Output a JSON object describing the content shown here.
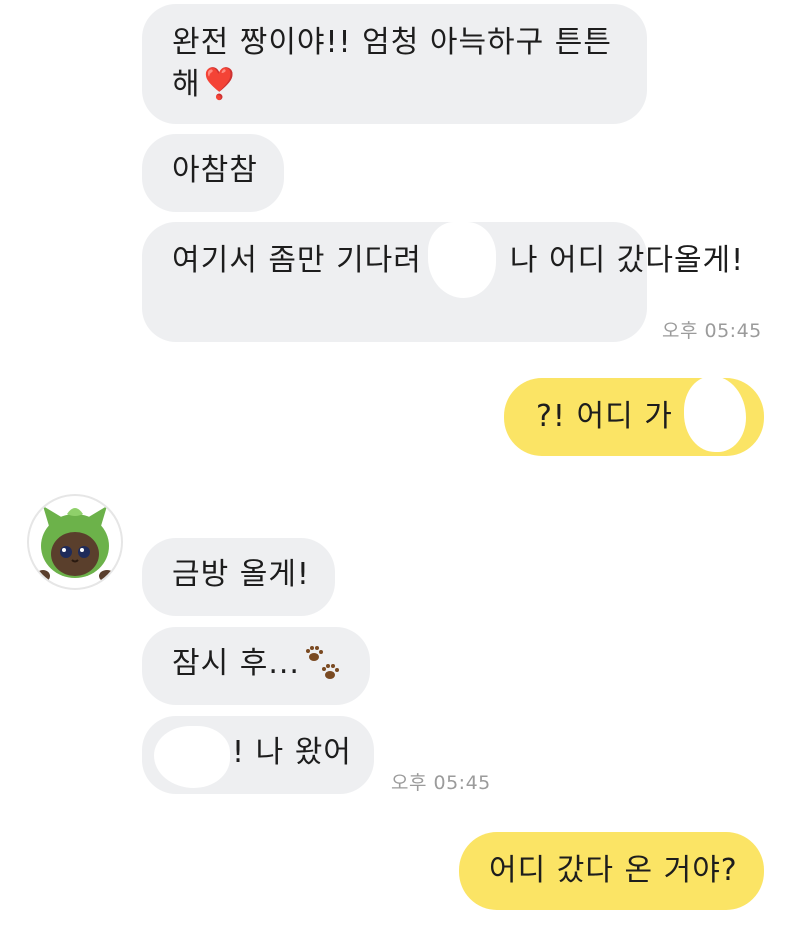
{
  "messages": [
    {
      "side": "in",
      "text": "완전 짱이야!! 엄청 아늑하구 튼튼해❣️"
    },
    {
      "side": "in",
      "text": "아참참"
    },
    {
      "side": "in",
      "text_before": "여기서 좀만 기다려",
      "text_after": "나 어디 갔다올게!",
      "time": "오후 05:45"
    },
    {
      "side": "out",
      "text": "?! 어디 가"
    },
    {
      "side": "in",
      "text": "금방 올게!"
    },
    {
      "side": "in",
      "text": "잠시 후...",
      "icon": "paw-prints-icon"
    },
    {
      "side": "in",
      "text": "! 나 왔어",
      "time": "오후 05:45"
    },
    {
      "side": "out",
      "text": "어디 갔다 온 거야?"
    }
  ],
  "avatar": {
    "icon": "green-cat-avatar-icon"
  },
  "colors": {
    "incoming_bubble": "#eeeff1",
    "outgoing_bubble": "#fbe465",
    "timestamp": "#9b9b9b"
  }
}
